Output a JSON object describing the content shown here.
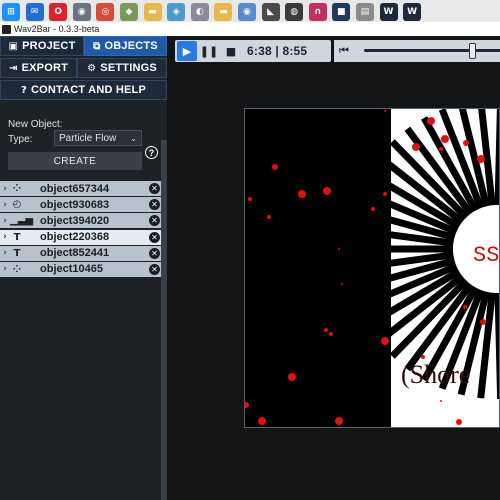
{
  "taskbar": {
    "icons": [
      {
        "name": "windows-start-icon",
        "color": "#1e90ff",
        "glyph": "⊞"
      },
      {
        "name": "mail-icon",
        "color": "#1e6fd0",
        "glyph": "✉"
      },
      {
        "name": "opera-icon",
        "color": "#e0202a",
        "glyph": "O"
      },
      {
        "name": "camera-icon",
        "color": "#6a7480",
        "glyph": "◉"
      },
      {
        "name": "chrome-icon",
        "color": "#d84a3a",
        "glyph": "◎"
      },
      {
        "name": "app-icon",
        "color": "#7a9a5a",
        "glyph": "◆"
      },
      {
        "name": "folder-icon",
        "color": "#e6b84a",
        "glyph": "▬"
      },
      {
        "name": "app-icon",
        "color": "#4a9ad0",
        "glyph": "◈"
      },
      {
        "name": "app-icon",
        "color": "#8a8a9a",
        "glyph": "◐"
      },
      {
        "name": "folder-icon",
        "color": "#e6b84a",
        "glyph": "▬"
      },
      {
        "name": "app-icon",
        "color": "#5a8ad0",
        "glyph": "◉"
      },
      {
        "name": "alien-icon",
        "color": "#4a4a4a",
        "glyph": "◣"
      },
      {
        "name": "app-icon",
        "color": "#3a3a3a",
        "glyph": "◍"
      },
      {
        "name": "headphones-icon",
        "color": "#c03060",
        "glyph": "∩"
      },
      {
        "name": "app-icon",
        "color": "#1f3a5a",
        "glyph": "■"
      },
      {
        "name": "app-icon",
        "color": "#8a8a8a",
        "glyph": "▤"
      },
      {
        "name": "wav2bar-icon",
        "color": "#1a2a3a",
        "glyph": "W"
      },
      {
        "name": "wav2bar-icon",
        "color": "#1a2a3a",
        "glyph": "W"
      }
    ]
  },
  "window": {
    "title": "Wav2Bar - 0.3.3-beta"
  },
  "nav": {
    "project": "PROJECT",
    "objects": "OBJECTS",
    "export": "EXPORT",
    "settings": "SETTINGS",
    "contact": "CONTACT AND HELP"
  },
  "new_object": {
    "heading": "New Object:",
    "type_label": "Type:",
    "type_value": "Particle Flow",
    "create_label": "CREATE",
    "help_glyph": "?"
  },
  "objects": [
    {
      "name": "object657344",
      "icon": "particle-icon",
      "glyph": "⁘",
      "selected": false
    },
    {
      "name": "object930683",
      "icon": "timer-icon",
      "glyph": "◴",
      "selected": false
    },
    {
      "name": "object394020",
      "icon": "bars-icon",
      "glyph": "▁▃▅",
      "selected": false
    },
    {
      "name": "object220368",
      "icon": "text-icon",
      "glyph": "T",
      "selected": true
    },
    {
      "name": "object852441",
      "icon": "text-icon",
      "glyph": "T",
      "selected": false
    },
    {
      "name": "object10465",
      "icon": "particle-icon",
      "glyph": "⁘",
      "selected": false
    }
  ],
  "player": {
    "time": "6:38 | 8:55",
    "seek_fraction": 0.77
  },
  "preview": {
    "visible_text_top": "SS",
    "visible_text_bottom": "(Shore",
    "colors": {
      "particle": "#e01010",
      "bars": "#000000",
      "text": "#c01010",
      "bg_left": "#000000",
      "bg_right": "#ffffff"
    }
  }
}
